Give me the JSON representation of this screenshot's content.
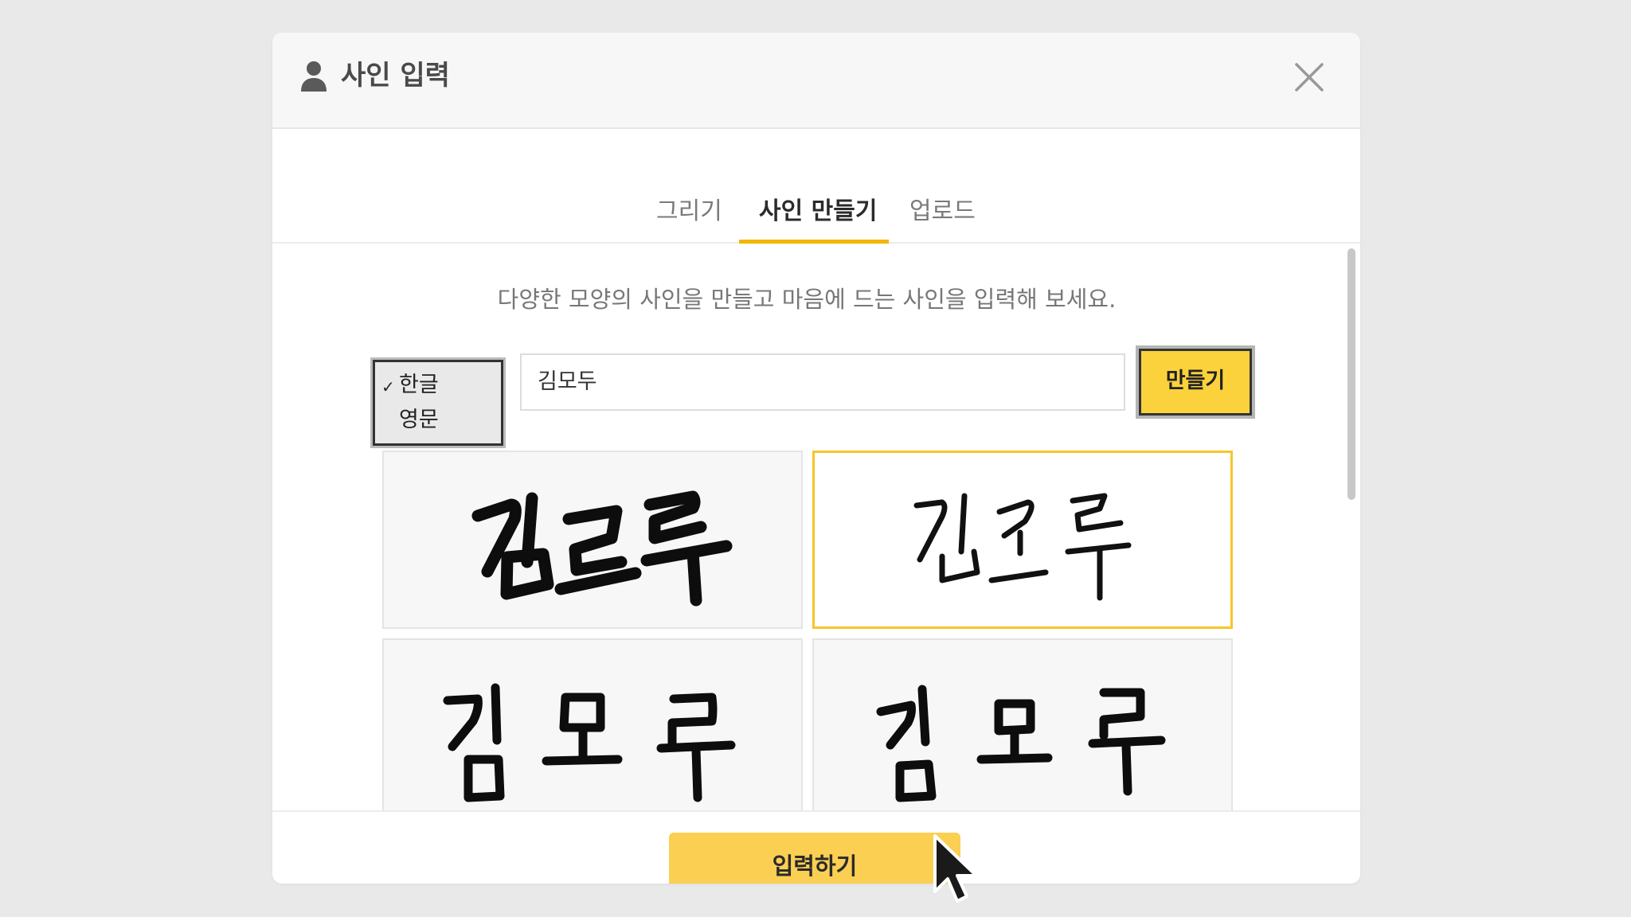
{
  "modal": {
    "title": "사인 입력",
    "icons": {
      "title": "user-icon",
      "close": "close-icon"
    }
  },
  "tabs": [
    {
      "label": "그리기",
      "active": false
    },
    {
      "label": "사인 만들기",
      "active": true
    },
    {
      "label": "업로드",
      "active": false
    }
  ],
  "description": "다양한 모양의 사인을 만들고 마음에 드는 사인을 입력해 보세요.",
  "language_select": {
    "options": [
      "한글",
      "영문"
    ],
    "selected": "한글",
    "check_mark": "✓"
  },
  "name_input": {
    "value": "김모두"
  },
  "make_button": {
    "label": "만들기"
  },
  "signature_options": [
    {
      "text": "김모두",
      "selected": false
    },
    {
      "text": "김모두",
      "selected": true
    },
    {
      "text": "김 모 두",
      "selected": false
    },
    {
      "text": "김 모 두",
      "selected": false
    }
  ],
  "footer": {
    "submit_label": "입력하기"
  },
  "colors": {
    "accent": "#fcd23c",
    "selected_border": "#f7c52c",
    "tab_underline": "#f2b600"
  }
}
